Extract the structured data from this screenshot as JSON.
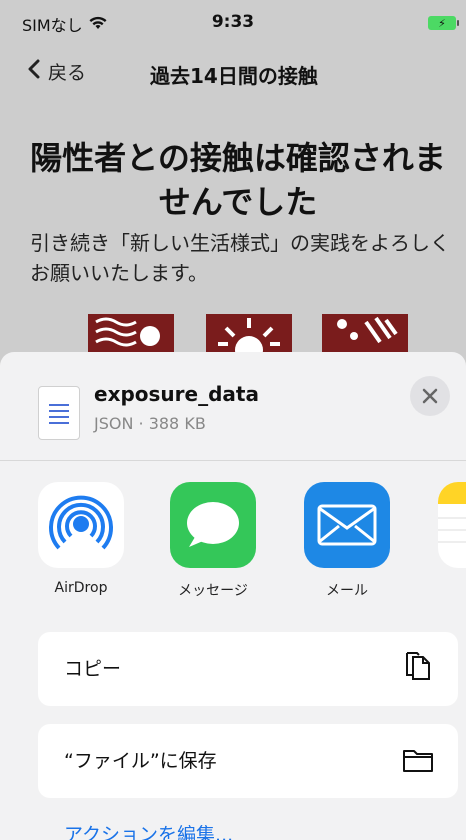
{
  "status_bar": {
    "carrier": "SIMなし",
    "time": "9:33"
  },
  "nav": {
    "back_label": "戻る",
    "title": "過去14日間の接触"
  },
  "content": {
    "headline": "陽性者との接触は確認されませんでした",
    "subtext": "引き続き「新しい生活様式」の実践をよろしくお願いいたします。"
  },
  "share_sheet": {
    "file_name": "exposure_data",
    "file_meta": "JSON · 388 KB",
    "apps": [
      {
        "label": "AirDrop",
        "icon": "airdrop-icon"
      },
      {
        "label": "メッセージ",
        "icon": "messages-icon"
      },
      {
        "label": "メール",
        "icon": "mail-icon"
      },
      {
        "label": "",
        "icon": "notes-icon"
      }
    ],
    "actions": [
      {
        "label": "コピー",
        "icon": "copy-icon"
      },
      {
        "label": "“ファイル”に保存",
        "icon": "folder-icon"
      }
    ],
    "edit_actions_label": "アクションを編集..."
  },
  "colors": {
    "accent": "#1a73e8",
    "messages_green": "#34c759",
    "mail_blue": "#1e88e5",
    "background_red": "#7a1c1c"
  }
}
